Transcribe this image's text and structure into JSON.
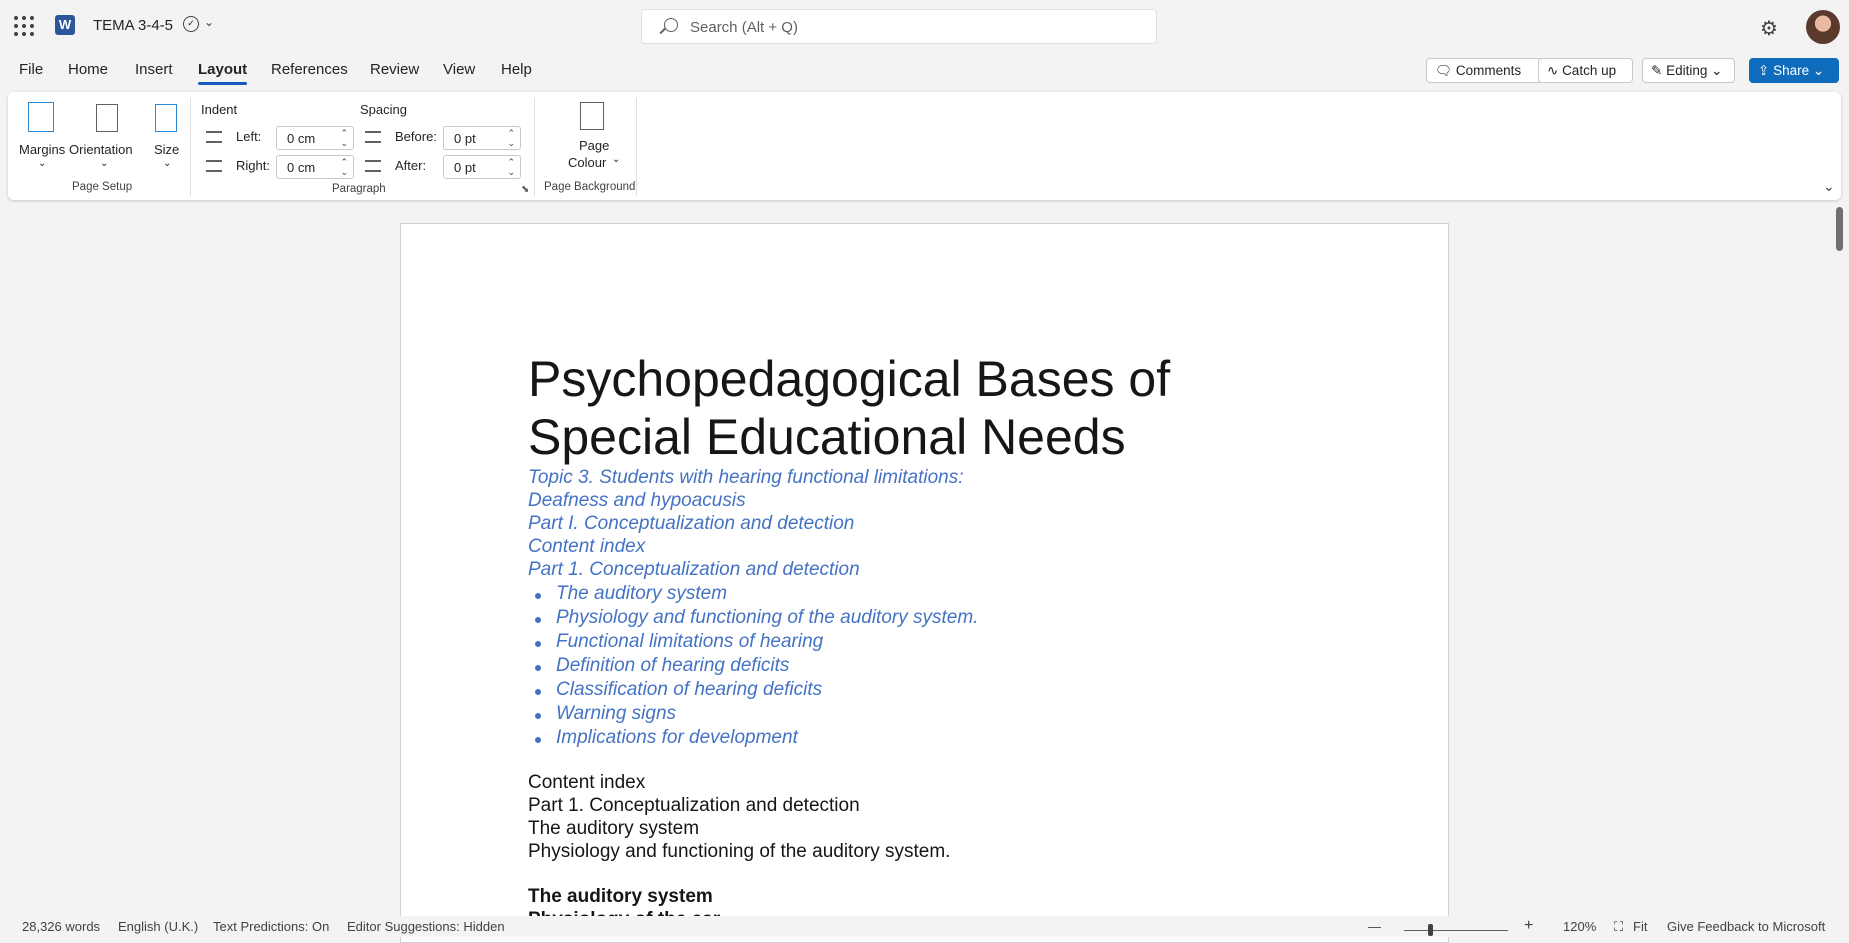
{
  "titlebar": {
    "doc_title": "TEMA 3-4-5",
    "app_icon_letter": "W",
    "search_placeholder": "Search (Alt + Q)"
  },
  "menu": {
    "items": [
      "File",
      "Home",
      "Insert",
      "Layout",
      "References",
      "Review",
      "View",
      "Help"
    ],
    "active": "Layout"
  },
  "actions": {
    "comments": "Comments",
    "catch_up": "Catch up",
    "editing": "Editing",
    "share": "Share"
  },
  "ribbon": {
    "page_setup": {
      "margins": "Margins",
      "orientation": "Orientation",
      "size": "Size",
      "group_label": "Page Setup"
    },
    "paragraph": {
      "indent_title": "Indent",
      "left_label": "Left:",
      "left_value": "0 cm",
      "right_label": "Right:",
      "right_value": "0 cm",
      "spacing_title": "Spacing",
      "before_label": "Before:",
      "before_value": "0 pt",
      "after_label": "After:",
      "after_value": "0 pt",
      "group_label": "Paragraph"
    },
    "page_background": {
      "page_colour_line1": "Page",
      "page_colour_line2": "Colour",
      "group_label": "Page Background"
    }
  },
  "document": {
    "title_line1": "Psychopedagogical Bases of",
    "title_line2": "Special Educational Needs",
    "blue_lines": [
      "Topic 3. Students with hearing functional limitations:",
      "Deafness and hypoacusis",
      "Part I. Conceptualization and detection",
      "Content index",
      "Part 1. Conceptualization and detection"
    ],
    "bullets": [
      "The auditory system",
      "Physiology and functioning of the auditory system.",
      "Functional limitations of hearing",
      "Definition of hearing deficits",
      "Classification of hearing deficits",
      "Warning signs",
      "Implications for development"
    ],
    "black_lines": [
      "Content index",
      "Part 1. Conceptualization and detection",
      "The auditory system",
      "Physiology and functioning of the auditory system."
    ],
    "heading": "The auditory system",
    "heading2": "Physiology of the ear"
  },
  "status": {
    "words": "28,326 words",
    "language": "English (U.K.)",
    "text_predictions": "Text Predictions: On",
    "editor_suggestions": "Editor Suggestions: Hidden",
    "zoom_minus": "—",
    "zoom_plus": "+",
    "zoom": "120%",
    "fit": "Fit",
    "feedback": "Give Feedback to Microsoft"
  },
  "colors": {
    "accent": "#185abd",
    "heading_blue": "#4472c4",
    "share_bg": "#0f6cbd"
  }
}
